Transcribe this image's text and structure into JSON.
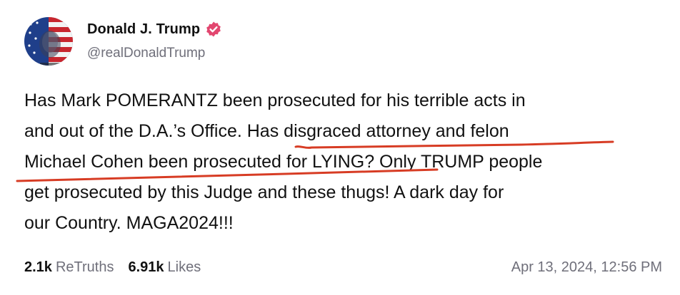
{
  "author": {
    "display_name": "Donald J. Trump",
    "handle": "@realDonaldTrump",
    "verified_icon": "verified-badge-icon",
    "verified_color": "#e2466f"
  },
  "post": {
    "lines": [
      "Has Mark POMERANTZ been prosecuted for his terrible acts in",
      "and out of the D.A.’s Office. Has disgraced attorney and felon",
      "Michael Cohen been prosecuted for LYING? Only TRUMP people",
      "get prosecuted by this Judge and these thugs!  A dark day for",
      "our Country. MAGA2024!!!"
    ],
    "annotation_color": "#d73c24"
  },
  "stats": {
    "retruths_count": "2.1k",
    "retruths_label": "ReTruths",
    "likes_count": "6.91k",
    "likes_label": "Likes"
  },
  "timestamp": "Apr 13, 2024, 12:56 PM"
}
